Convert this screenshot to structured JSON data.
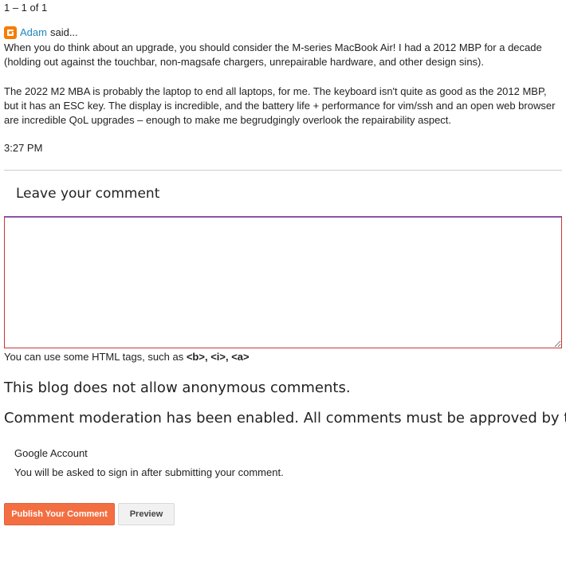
{
  "pager": {
    "text": "1 – 1 of 1"
  },
  "comment": {
    "author": "Adam",
    "said": "said...",
    "paragraph_1": "When you do think about an upgrade, you should consider the M-series MacBook Air! I had a 2012 MBP for a decade (holding out against the touchbar, non-magsafe chargers, unrepairable hardware, and other design sins).",
    "paragraph_2": "The 2022 M2 MBA is probably the laptop to end all laptops, for me. The keyboard isn't quite as good as the 2012 MBP, but it has an ESC key. The display is incredible, and the battery life + performance for vim/ssh and an open web browser are incredible QoL upgrades – enough to make me begrudgingly overlook the repairability aspect.",
    "time": "3:27 PM",
    "author_icon": "blogger-icon"
  },
  "form": {
    "title": "Leave your comment",
    "textarea_value": "",
    "html_hint_prefix": "You can use some HTML tags, such as",
    "html_hint_tags": "<b>, <i>, <a>",
    "notice_anonymous": "This blog does not allow anonymous comments.",
    "notice_moderation": "Comment moderation has been enabled. All comments must be approved by the blog author.",
    "account_label": "Google Account",
    "account_note": "You will be asked to sign in after submitting your comment.",
    "publish_label": "Publish Your Comment",
    "preview_label": "Preview"
  },
  "colors": {
    "accent": "#f36f42",
    "link": "#2288bb",
    "blogger_orange": "#f57d00"
  }
}
